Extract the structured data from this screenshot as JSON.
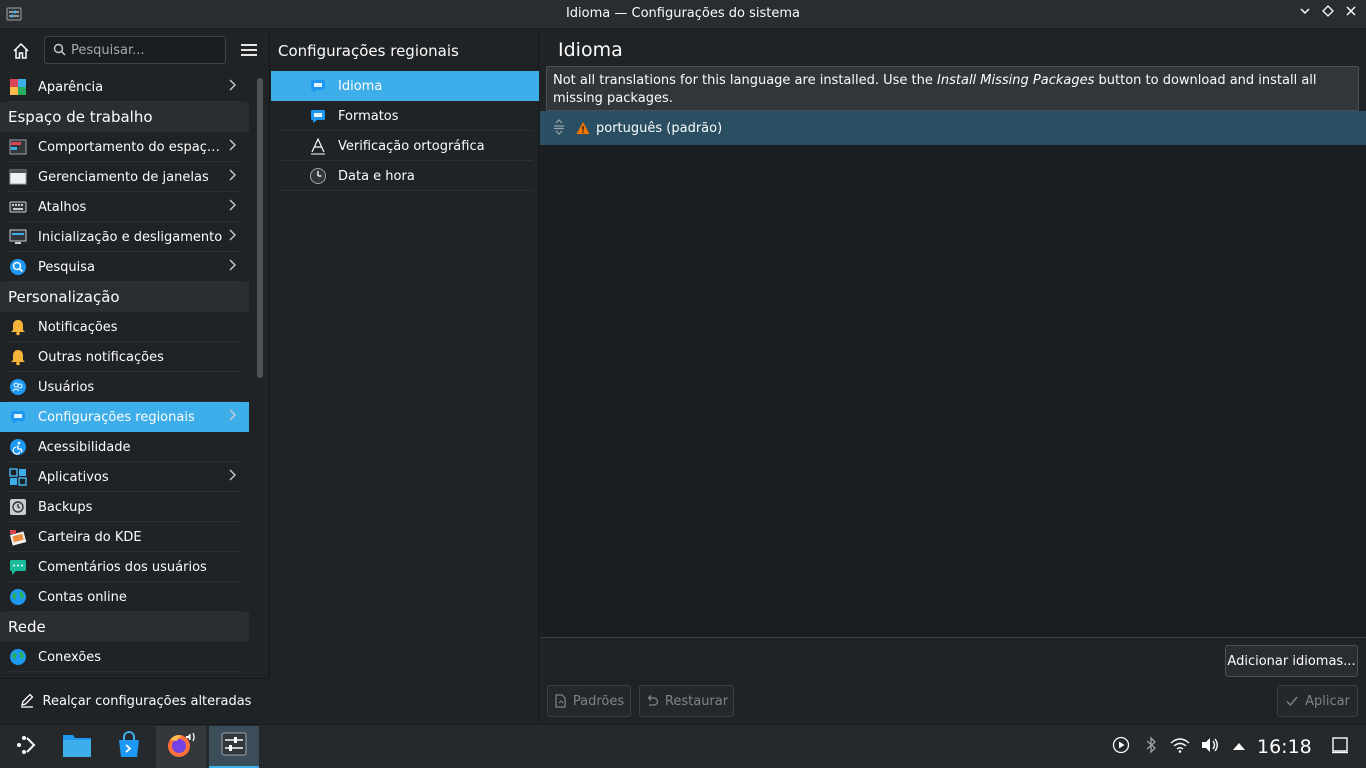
{
  "window": {
    "title": "Idioma — Configurações do sistema"
  },
  "sidebar": {
    "search_placeholder": "Pesquisar...",
    "sections": [
      {
        "type": "item",
        "label": "Aparência",
        "icon": "appearance-icon",
        "has_children": true
      },
      {
        "type": "header",
        "label": "Espaço de trabalho"
      },
      {
        "type": "item",
        "label": "Comportamento do espaço...",
        "icon": "workspace-behavior-icon",
        "has_children": true
      },
      {
        "type": "item",
        "label": "Gerenciamento de janelas",
        "icon": "window-management-icon",
        "has_children": true
      },
      {
        "type": "item",
        "label": "Atalhos",
        "icon": "keyboard-icon",
        "has_children": true
      },
      {
        "type": "item",
        "label": "Inicialização e desligamento",
        "icon": "startup-icon",
        "has_children": true
      },
      {
        "type": "item",
        "label": "Pesquisa",
        "icon": "search-icon",
        "has_children": true
      },
      {
        "type": "header",
        "label": "Personalização"
      },
      {
        "type": "item",
        "label": "Notificações",
        "icon": "bell-icon",
        "has_children": false
      },
      {
        "type": "item",
        "label": "Outras notificações",
        "icon": "bell-icon",
        "has_children": false
      },
      {
        "type": "item",
        "label": "Usuários",
        "icon": "users-icon",
        "has_children": false
      },
      {
        "type": "item",
        "label": "Configurações regionais",
        "icon": "regional-icon",
        "has_children": true,
        "selected": true
      },
      {
        "type": "item",
        "label": "Acessibilidade",
        "icon": "accessibility-icon",
        "has_children": false
      },
      {
        "type": "item",
        "label": "Aplicativos",
        "icon": "applications-icon",
        "has_children": true
      },
      {
        "type": "item",
        "label": "Backups",
        "icon": "backup-icon",
        "has_children": false
      },
      {
        "type": "item",
        "label": "Carteira do KDE",
        "icon": "wallet-icon",
        "has_children": false
      },
      {
        "type": "item",
        "label": "Comentários dos usuários",
        "icon": "feedback-icon",
        "has_children": false
      },
      {
        "type": "item",
        "label": "Contas online",
        "icon": "globe-icon",
        "has_children": false
      },
      {
        "type": "header",
        "label": "Rede"
      },
      {
        "type": "item",
        "label": "Conexões",
        "icon": "globe-icon",
        "has_children": false
      }
    ],
    "highlight_button": "Realçar configurações alteradas"
  },
  "middle": {
    "heading": "Configurações regionais",
    "items": [
      {
        "label": "Idioma",
        "icon": "language-icon",
        "selected": true
      },
      {
        "label": "Formatos",
        "icon": "formats-icon",
        "selected": false
      },
      {
        "label": "Verificação ortográfica",
        "icon": "spellcheck-icon",
        "selected": false
      },
      {
        "label": "Data e hora",
        "icon": "clock-icon",
        "selected": false
      }
    ]
  },
  "content": {
    "page_title": "Idioma",
    "banner": {
      "prefix": "Not all translations for this language are installed. Use the ",
      "emphasis": "Install Missing Packages",
      "suffix": " button to download and install all missing packages."
    },
    "languages": [
      {
        "label": "português (padrão)",
        "warning": true
      }
    ],
    "add_languages_button": "Adicionar idiomas...",
    "defaults_button": "Padrões",
    "reset_button": "Restaurar",
    "apply_button": "Aplicar"
  },
  "taskbar": {
    "clock": "16:18",
    "tasks": [
      "application-launcher-icon",
      "file-manager-icon",
      "discover-icon",
      "firefox-icon",
      "system-settings-icon"
    ],
    "tray": [
      "media-play-icon",
      "bluetooth-icon",
      "wifi-icon",
      "volume-icon",
      "expand-tray-icon",
      "show-desktop-icon"
    ]
  },
  "colors": {
    "accent": "#3daee9",
    "background": "#202326",
    "selected_row": "#2b4f62",
    "warning": "#f67400"
  }
}
